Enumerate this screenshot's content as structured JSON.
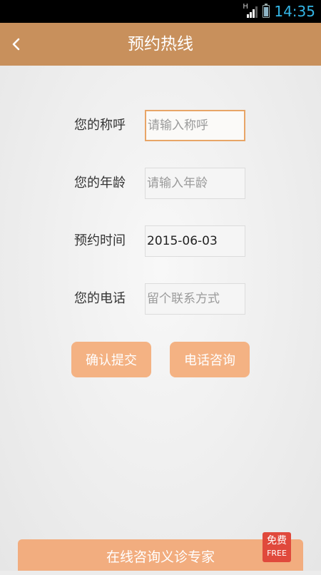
{
  "status_bar": {
    "network_type": "H",
    "time": "14:35"
  },
  "header": {
    "title": "预约热线",
    "back_icon": "chevron-left-icon"
  },
  "form": {
    "name": {
      "label": "您的称呼",
      "value": "",
      "placeholder": "请输入称呼"
    },
    "age": {
      "label": "您的年龄",
      "value": "",
      "placeholder": "请输入年龄"
    },
    "time": {
      "label": "预约时间",
      "value": "2015-06-03",
      "placeholder": ""
    },
    "phone": {
      "label": "您的电话",
      "value": "",
      "placeholder": "留个联系方式"
    }
  },
  "actions": {
    "submit_label": "确认提交",
    "call_label": "电话咨询"
  },
  "bottom": {
    "online_label": "在线咨询义诊专家",
    "badge_cn": "免费",
    "badge_en": "FREE"
  },
  "colors": {
    "header_bg": "#c8905c",
    "button_bg": "#f4b283",
    "badge_bg": "#e0493c",
    "clock": "#34b5e5"
  }
}
